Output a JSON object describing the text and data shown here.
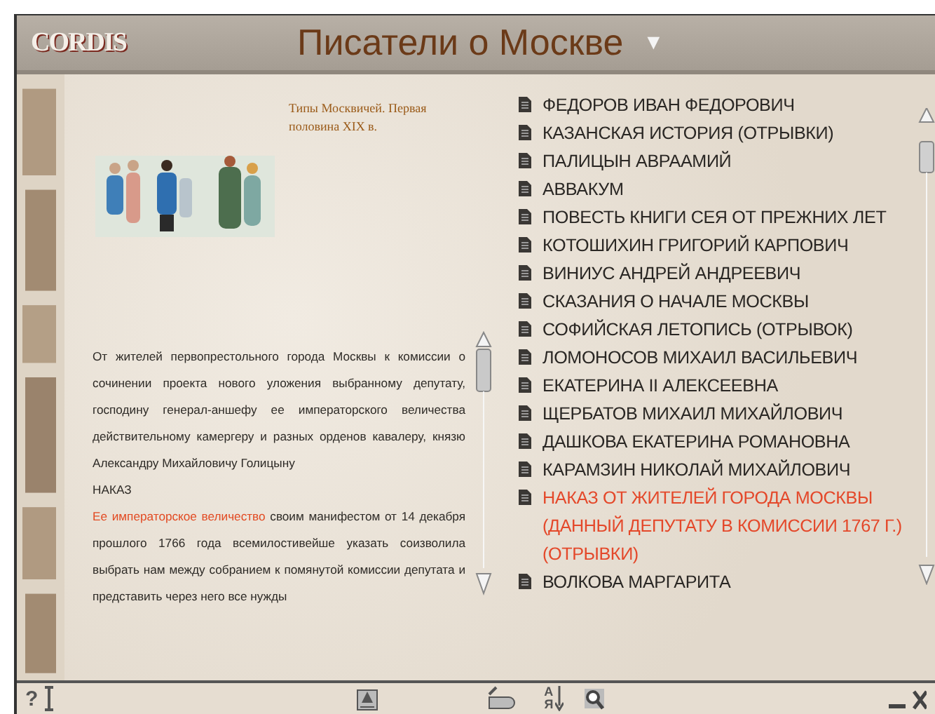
{
  "header": {
    "logo": "CORDIS",
    "title": "Писатели о Москве",
    "menu_toggle": "▼"
  },
  "article": {
    "caption": "Типы Москвичей. Первая половина XIX в.",
    "paragraphs": [
      {
        "text": "От жителей первопрестольного города Москвы к комиссии о сочинении проекта нового уложения выбранному депутату, господину генерал-аншефу ее императорского величества действительному камергеру и разных орденов кавалеру, князю Александру Михайловичу Голицыну"
      },
      {
        "text": "НАКАЗ"
      },
      {
        "link": "Ее императорское величество",
        "text": " своим манифестом от 14 декабря прошлого 1766 года всемилостивейше указать соизволила выбрать нам между собранием к помянутой комиссии депутата и представить через него все нужды"
      }
    ]
  },
  "contents": [
    {
      "title": "ФЕДОРОВ ИВАН ФЕДОРОВИЧ",
      "selected": false
    },
    {
      "title": "КАЗАНСКАЯ ИСТОРИЯ (ОТРЫВКИ)",
      "selected": false
    },
    {
      "title": "ПАЛИЦЫН АВРААМИЙ",
      "selected": false
    },
    {
      "title": "АВВАКУМ",
      "selected": false
    },
    {
      "title": "ПОВЕСТЬ КНИГИ СЕЯ ОТ ПРЕЖНИХ ЛЕТ",
      "selected": false
    },
    {
      "title": "КОТОШИХИН ГРИГОРИЙ КАРПОВИЧ",
      "selected": false
    },
    {
      "title": "ВИНИУС АНДРЕЙ АНДРЕЕВИЧ",
      "selected": false
    },
    {
      "title": "СКАЗАНИЯ О НАЧАЛЕ МОСКВЫ",
      "selected": false
    },
    {
      "title": "СОФИЙСКАЯ ЛЕТОПИСЬ (ОТРЫВОК)",
      "selected": false
    },
    {
      "title": "ЛОМОНОСОВ МИХАИЛ ВАСИЛЬЕВИЧ",
      "selected": false
    },
    {
      "title": "ЕКАТЕРИНА II АЛЕКСЕЕВНА",
      "selected": false
    },
    {
      "title": "ЩЕРБАТОВ МИХАИЛ МИХАЙЛОВИЧ",
      "selected": false
    },
    {
      "title": "ДАШКОВА ЕКАТЕРИНА РОМАНОВНА",
      "selected": false
    },
    {
      "title": "КАРАМЗИН НИКОЛАЙ МИХАЙЛОВИЧ",
      "selected": false
    },
    {
      "title": "НАКАЗ ОТ ЖИТЕЛЕЙ ГОРОДА МОСКВЫ (ДАННЫЙ ДЕПУТАТУ В КОМИССИИ 1767 Г.) (ОТРЫВКИ)",
      "selected": true
    },
    {
      "title": "ВОЛКОВА МАРГАРИТА",
      "selected": false
    }
  ],
  "toolbar": {
    "help": "?",
    "sort_top": "А",
    "sort_bottom": "Я"
  }
}
